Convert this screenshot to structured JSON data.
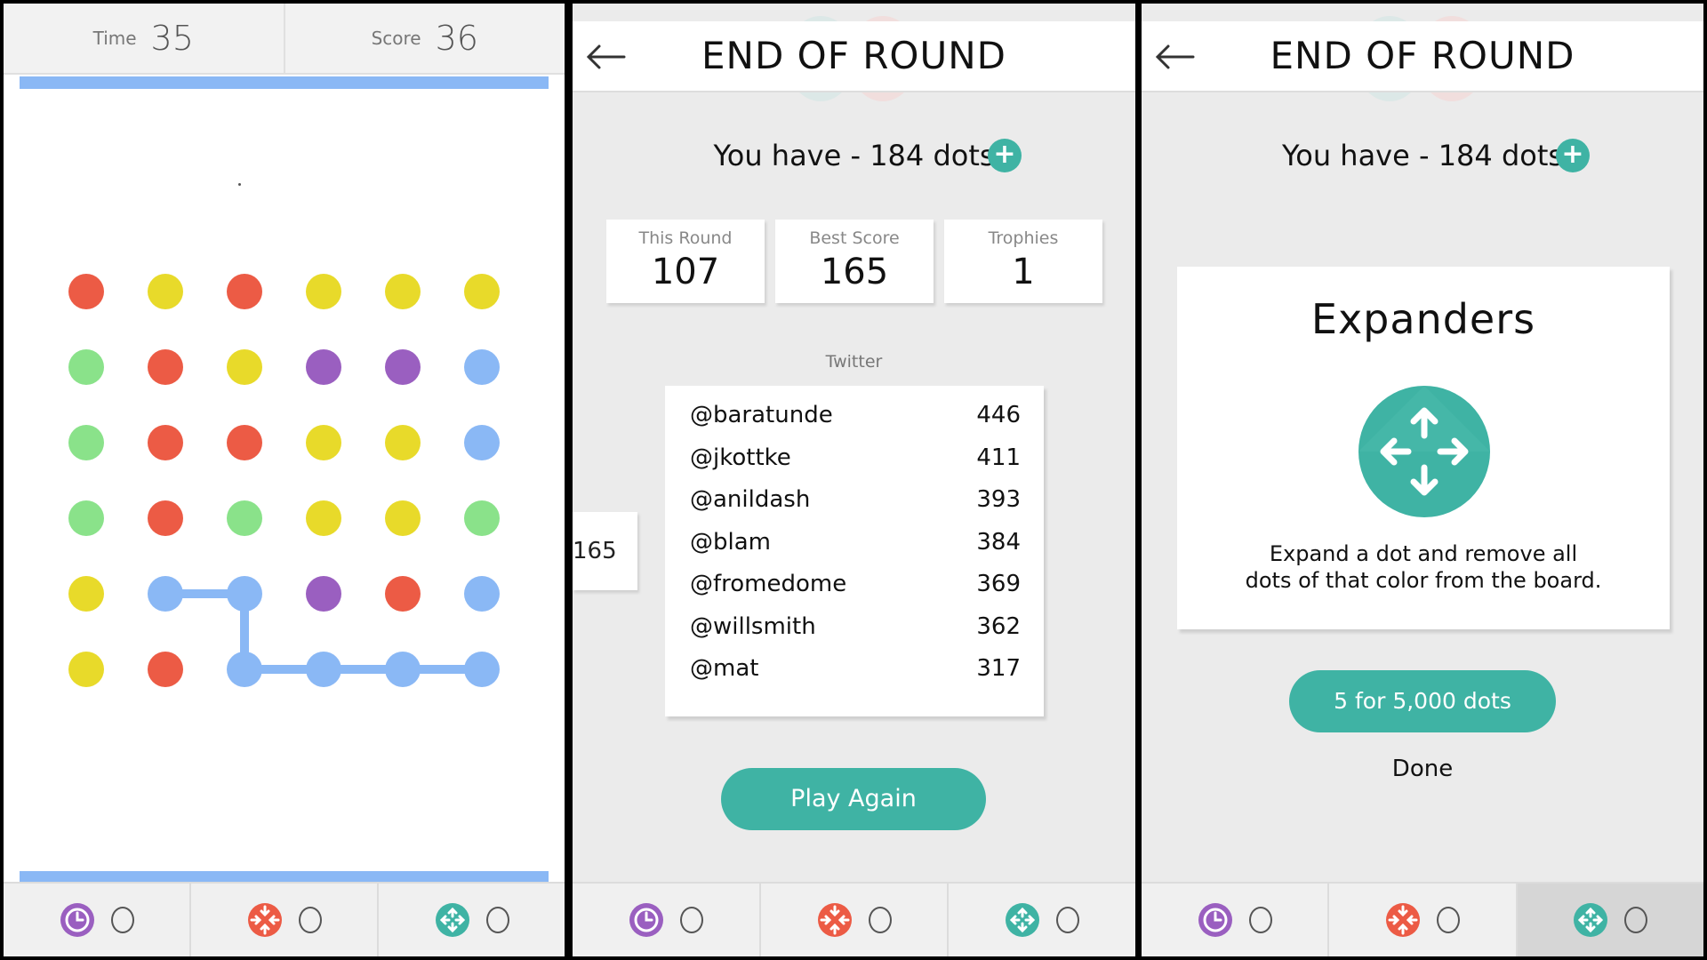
{
  "game": {
    "time_label": "Time",
    "time_value": "35",
    "score_label": "Score",
    "score_value": "36",
    "colors": {
      "red": "#ec5b45",
      "yellow": "#e8da2a",
      "green": "#8ae28a",
      "purple": "#9a5fc0",
      "blue": "#8ab8f5"
    },
    "grid": [
      [
        "red",
        "yellow",
        "red",
        "yellow",
        "yellow",
        "yellow"
      ],
      [
        "green",
        "red",
        "yellow",
        "purple",
        "purple",
        "blue"
      ],
      [
        "green",
        "red",
        "red",
        "yellow",
        "yellow",
        "blue"
      ],
      [
        "green",
        "red",
        "green",
        "yellow",
        "yellow",
        "green"
      ],
      [
        "yellow",
        "blue",
        "blue",
        "purple",
        "red",
        "blue"
      ],
      [
        "yellow",
        "red",
        "blue",
        "blue",
        "blue",
        "blue"
      ]
    ],
    "connected_path": [
      [
        4,
        1
      ],
      [
        4,
        2
      ],
      [
        5,
        2
      ],
      [
        5,
        3
      ],
      [
        5,
        4
      ],
      [
        5,
        5
      ]
    ],
    "progress_fraction": 1.0
  },
  "powerups": [
    {
      "name": "time-stop",
      "icon": "clock-icon",
      "color": "#9a5fc0",
      "count": "0"
    },
    {
      "name": "shrinker",
      "icon": "shrinker-icon",
      "color": "#ec5b45",
      "count": "0"
    },
    {
      "name": "expander",
      "icon": "expander-icon",
      "color": "#3fb3a4",
      "count": "0"
    }
  ],
  "end_round": {
    "title": "END OF ROUND",
    "dots_text": "You have - 184 dots",
    "accent": "#3fb3a4",
    "stats": [
      {
        "label": "This Round",
        "value": "107"
      },
      {
        "label": "Best Score",
        "value": "165"
      },
      {
        "label": "Trophies",
        "value": "1"
      }
    ],
    "leaderboard_title": "Twitter",
    "leaderboard": [
      {
        "handle": "@baratunde",
        "score": "446"
      },
      {
        "handle": "@jkottke",
        "score": "411"
      },
      {
        "handle": "@anildash",
        "score": "393"
      },
      {
        "handle": "@blam",
        "score": "384"
      },
      {
        "handle": "@fromedome",
        "score": "369"
      },
      {
        "handle": "@willsmith",
        "score": "362"
      },
      {
        "handle": "@mat",
        "score": "317"
      }
    ],
    "side_card_value": "165",
    "play_again": "Play Again"
  },
  "store": {
    "title": "END OF ROUND",
    "dots_text": "You have - 184 dots",
    "card_title": "Expanders",
    "card_desc_line1": "Expand a dot and remove all",
    "card_desc_line2": "dots of that color from the board.",
    "buy_label": "5 for 5,000 dots",
    "done_label": "Done"
  }
}
